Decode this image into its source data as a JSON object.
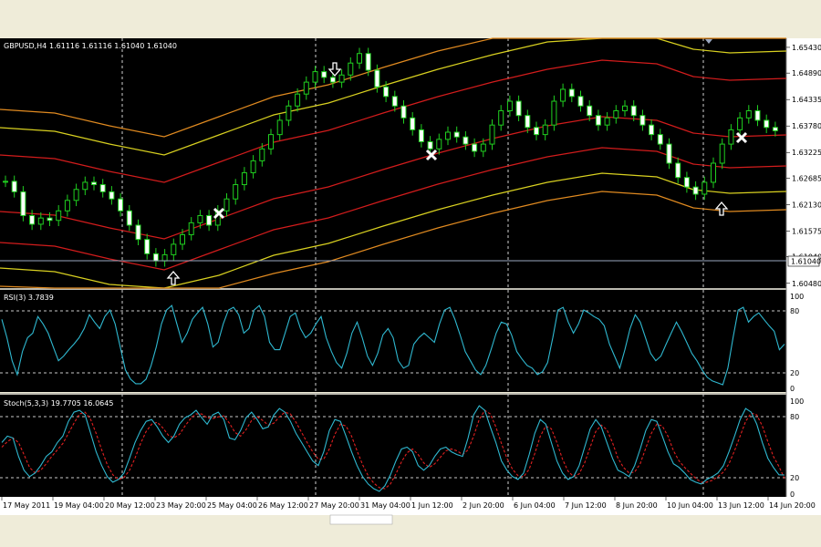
{
  "chart_data": {
    "type": "candlestick",
    "main": {
      "symbol_label": "GBPUSD,H4",
      "ohlc_label": "1.61116 1.61116 1.61040 1.61040",
      "current_price": "1.61040",
      "price_ticks": [
        "1.65430",
        "1.64890",
        "1.64335",
        "1.63780",
        "1.63225",
        "1.62685",
        "1.62130",
        "1.61575",
        "1.61040",
        "1.60480"
      ],
      "ylim": [
        1.6038,
        1.6562
      ]
    },
    "time_labels": [
      "17 May 2011",
      "19 May 04:00",
      "20 May 12:00",
      "23 May 20:00",
      "25 May 04:00",
      "26 May 12:00",
      "27 May 20:00",
      "31 May 04:00",
      "1 Jun 12:00",
      "2 Jun 20:00",
      "6 Jun 04:00",
      "7 Jun 12:00",
      "8 Jun 20:00",
      "10 Jun 04:00",
      "13 Jun 12:00",
      "14 Jun 20:00"
    ],
    "rsi": {
      "label": "RSI(3) 3.7839",
      "ticks": [
        "100",
        "80",
        "20",
        "0"
      ],
      "levels": [
        80,
        20
      ],
      "values": [
        75,
        55,
        30,
        15,
        40,
        55,
        60,
        78,
        70,
        60,
        45,
        30,
        35,
        42,
        48,
        55,
        65,
        80,
        72,
        65,
        78,
        85,
        70,
        45,
        20,
        10,
        5,
        5,
        10,
        25,
        45,
        70,
        85,
        90,
        70,
        50,
        60,
        75,
        82,
        88,
        70,
        45,
        50,
        70,
        85,
        88,
        80,
        60,
        65,
        85,
        90,
        78,
        50,
        42,
        42,
        60,
        78,
        82,
        65,
        55,
        60,
        70,
        78,
        55,
        40,
        28,
        22,
        38,
        60,
        72,
        55,
        35,
        25,
        38,
        58,
        65,
        55,
        30,
        22,
        25,
        48,
        55,
        60,
        55,
        50,
        70,
        85,
        88,
        75,
        58,
        40,
        30,
        20,
        15,
        25,
        42,
        60,
        72,
        70,
        58,
        40,
        32,
        25,
        22,
        15,
        18,
        28,
        55,
        85,
        88,
        72,
        60,
        70,
        85,
        82,
        78,
        75,
        68,
        48,
        35,
        22,
        42,
        65,
        80,
        72,
        55,
        38,
        30,
        35,
        48,
        60,
        72,
        62,
        50,
        38,
        30,
        20,
        12,
        8,
        6,
        4,
        22,
        55,
        85,
        88,
        72,
        78,
        82,
        75,
        68,
        62,
        42,
        48
      ]
    },
    "stoch": {
      "label": "Stoch(5,3,3) 19.7705 16.0645",
      "ticks": [
        "100",
        "80",
        "20",
        "0"
      ],
      "levels": [
        80,
        20
      ],
      "main_values": [
        55,
        62,
        60,
        40,
        25,
        18,
        22,
        30,
        40,
        45,
        55,
        62,
        78,
        88,
        90,
        85,
        65,
        45,
        30,
        18,
        12,
        15,
        22,
        38,
        55,
        68,
        78,
        80,
        72,
        62,
        55,
        62,
        75,
        82,
        85,
        90,
        82,
        75,
        85,
        88,
        80,
        60,
        58,
        68,
        82,
        88,
        80,
        70,
        72,
        85,
        92,
        88,
        78,
        65,
        55,
        45,
        35,
        30,
        45,
        68,
        80,
        78,
        62,
        45,
        30,
        18,
        10,
        5,
        2,
        8,
        20,
        35,
        48,
        50,
        45,
        30,
        25,
        30,
        40,
        48,
        50,
        45,
        42,
        40,
        60,
        85,
        95,
        90,
        72,
        55,
        35,
        25,
        18,
        15,
        22,
        42,
        65,
        80,
        75,
        55,
        35,
        22,
        15,
        18,
        30,
        50,
        70,
        80,
        72,
        55,
        38,
        25,
        22,
        18,
        30,
        48,
        68,
        80,
        78,
        62,
        45,
        32,
        28,
        22,
        15,
        12,
        10,
        15,
        18,
        22,
        30,
        45,
        62,
        80,
        92,
        88,
        75,
        55,
        38,
        28,
        20,
        19.77
      ],
      "signal_values": [
        50,
        56,
        60,
        55,
        42,
        28,
        22,
        25,
        32,
        40,
        47,
        54,
        65,
        76,
        86,
        88,
        80,
        65,
        47,
        31,
        20,
        15,
        17,
        25,
        38,
        54,
        67,
        75,
        77,
        71,
        63,
        60,
        64,
        73,
        81,
        86,
        86,
        82,
        81,
        83,
        84,
        76,
        66,
        62,
        69,
        79,
        83,
        79,
        74,
        76,
        83,
        88,
        86,
        77,
        66,
        55,
        45,
        37,
        37,
        48,
        64,
        75,
        73,
        62,
        46,
        31,
        19,
        11,
        6,
        5,
        10,
        21,
        34,
        44,
        48,
        42,
        33,
        28,
        32,
        39,
        46,
        48,
        46,
        42,
        47,
        62,
        80,
        90,
        86,
        72,
        54,
        38,
        26,
        19,
        18,
        26,
        43,
        62,
        73,
        70,
        55,
        37,
        24,
        18,
        21,
        33,
        50,
        67,
        74,
        69,
        55,
        38,
        28,
        22,
        23,
        32,
        49,
        65,
        75,
        73,
        62,
        46,
        35,
        28,
        22,
        16,
        12,
        12,
        14,
        18,
        23,
        32,
        46,
        62,
        78,
        87,
        85,
        73,
        56,
        40,
        29,
        16.06
      ]
    }
  }
}
